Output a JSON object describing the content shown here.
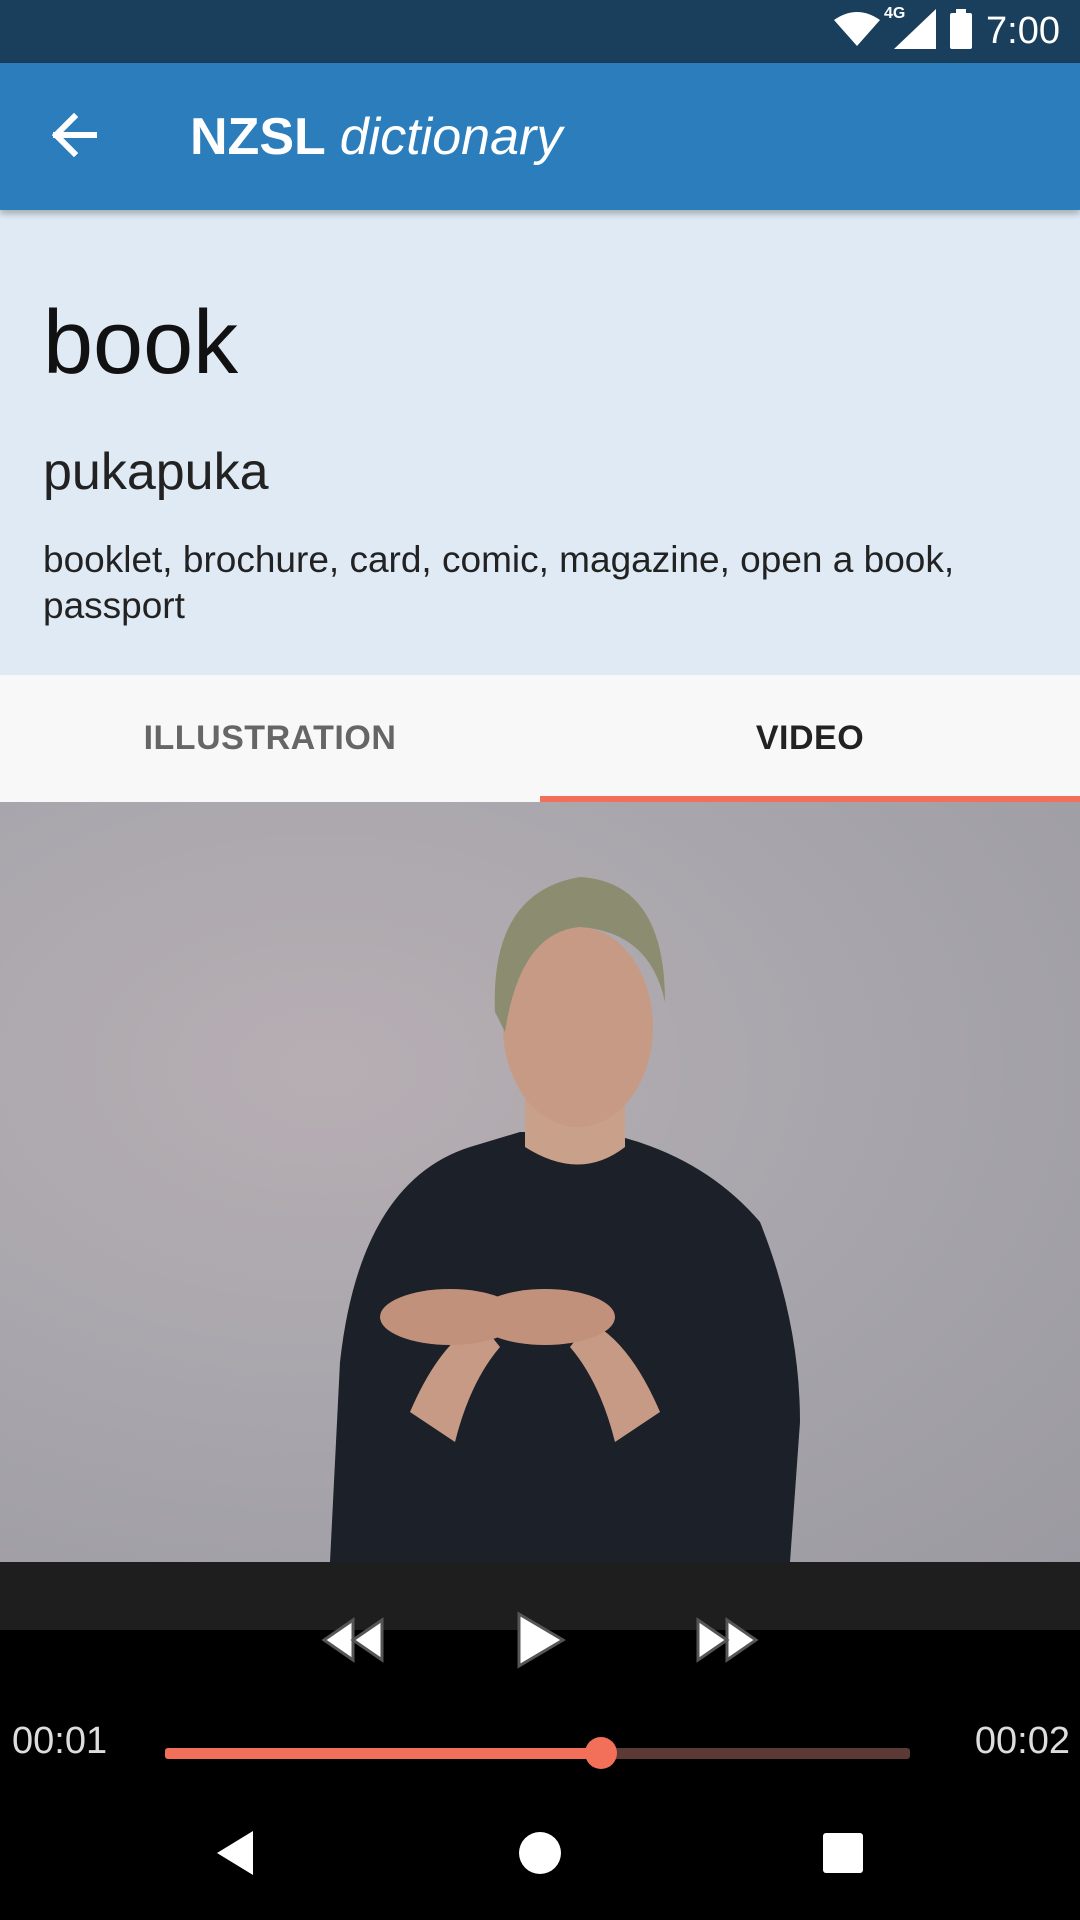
{
  "status_bar": {
    "time": "7:00",
    "network_label": "4G",
    "icons": [
      "wifi-icon",
      "cellular-signal-icon",
      "battery-icon"
    ]
  },
  "app_bar": {
    "title_bold": "NZSL",
    "title_italic": "dictionary",
    "back_icon": "arrow-back-icon"
  },
  "entry": {
    "word": "book",
    "maori": "pukapuka",
    "related": "booklet, brochure, card, comic, magazine, open a book, passport"
  },
  "tabs": [
    {
      "label": "ILLUSTRATION",
      "active": false
    },
    {
      "label": "VIDEO",
      "active": true
    }
  ],
  "player": {
    "current_time": "00:01",
    "duration": "00:02",
    "progress": 0.585,
    "icons": [
      "rewind-icon",
      "play-icon",
      "fast-forward-icon"
    ]
  },
  "nav_bar": {
    "icons": [
      "nav-back-icon",
      "nav-home-icon",
      "nav-recents-icon"
    ]
  },
  "colors": {
    "status_bar": "#1a3f5c",
    "app_bar": "#2b7dbb",
    "header_panel": "#dfeaf5",
    "accent": "#f2705a"
  }
}
